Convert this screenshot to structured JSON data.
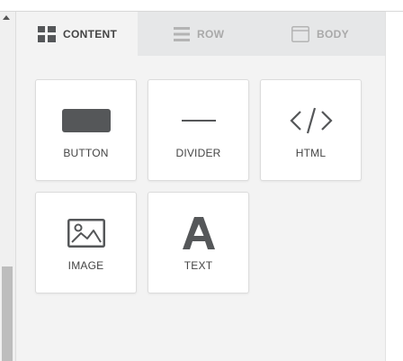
{
  "tabs": [
    {
      "label": "CONTENT",
      "icon": "grid-icon",
      "active": true
    },
    {
      "label": "ROW",
      "icon": "rows-icon",
      "active": false
    },
    {
      "label": "BODY",
      "icon": "window-icon",
      "active": false
    }
  ],
  "blocks": [
    {
      "label": "BUTTON",
      "icon": "button-icon"
    },
    {
      "label": "DIVIDER",
      "icon": "divider-icon"
    },
    {
      "label": "HTML",
      "icon": "code-icon"
    },
    {
      "label": "IMAGE",
      "icon": "image-icon"
    },
    {
      "label": "TEXT",
      "icon": "text-icon"
    }
  ],
  "colors": {
    "icon": "#555759",
    "panel_bg": "#f3f3f3",
    "tab_bar_bg": "#e6e7e8",
    "inactive_tab_text": "#a9a9a9"
  }
}
